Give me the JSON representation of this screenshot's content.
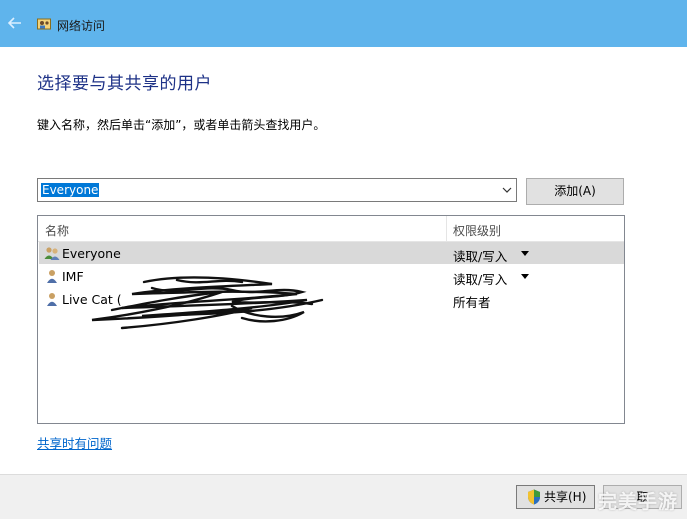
{
  "window": {
    "title": "网络访问"
  },
  "page": {
    "heading": "选择要与其共享的用户",
    "instruction": "键入名称，然后单击“添加”，或者单击箭头查找用户。"
  },
  "combo": {
    "value": "Everyone"
  },
  "add_button": {
    "label": "添加(A)"
  },
  "list": {
    "columns": {
      "name": "名称",
      "permission": "权限级别"
    },
    "rows": [
      {
        "name": "Everyone",
        "permission": "读取/写入",
        "icon": "group-icon",
        "selected": true,
        "has_dropdown": true
      },
      {
        "name": "IMF",
        "permission": "读取/写入",
        "icon": "user-icon",
        "selected": false,
        "has_dropdown": true
      },
      {
        "name": "Live Cat (",
        "permission": "所有者",
        "icon": "user-icon",
        "selected": false,
        "has_dropdown": false
      }
    ]
  },
  "help_link": "共享时有问题",
  "footer": {
    "share_label": "共享(H)",
    "cancel_label": "取"
  },
  "watermark": "完美手游",
  "colors": {
    "titlebar": "#5fb4ec",
    "heading": "#1e3287",
    "selection": "#0078d7",
    "link": "#0066cc"
  }
}
